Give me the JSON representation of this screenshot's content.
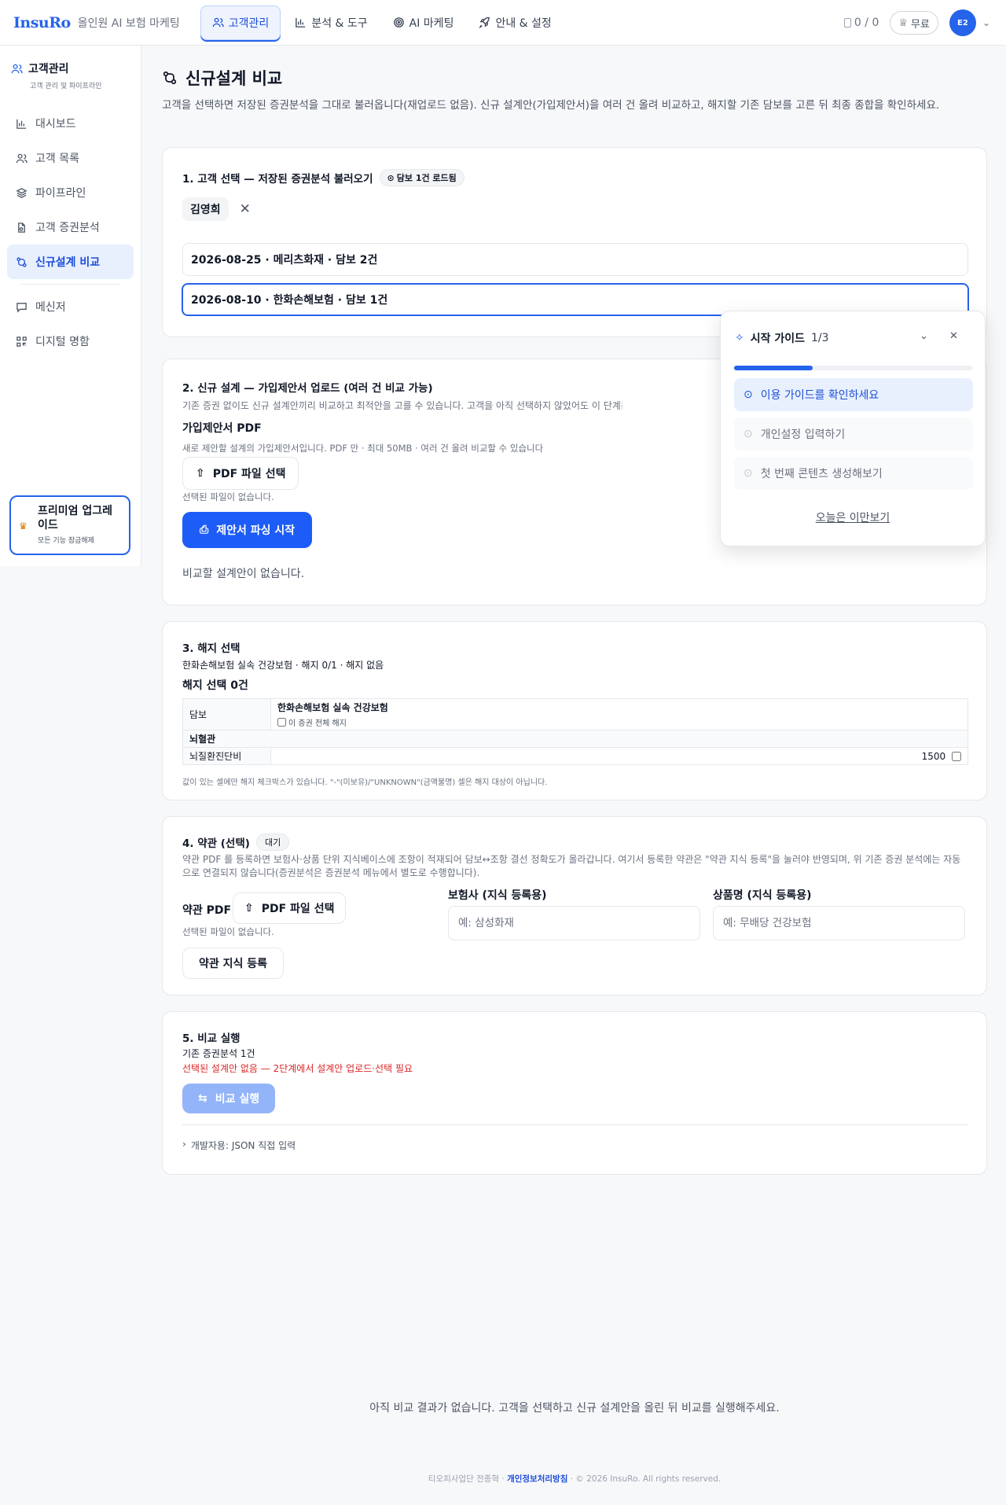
{
  "header": {
    "logo": "InsuRo",
    "logo_sub": "올인원 AI 보험 마케팅",
    "tabs": [
      {
        "label": "고객관리",
        "icon": "users-icon"
      },
      {
        "label": "분석 & 도구",
        "icon": "bar-chart-icon"
      },
      {
        "label": "AI 마케팅",
        "icon": "target-icon"
      },
      {
        "label": "안내 & 설정",
        "icon": "rocket-icon"
      }
    ],
    "credits": "0 / 0",
    "plan": "무료",
    "avatar": "E2"
  },
  "sidebar": {
    "title": "고객관리",
    "subtitle": "고객 관리 및 파이프라인",
    "items": [
      {
        "label": "대시보드",
        "icon": "bar-chart-icon"
      },
      {
        "label": "고객 목록",
        "icon": "users-icon"
      },
      {
        "label": "파이프라인",
        "icon": "layers-icon"
      },
      {
        "label": "고객 증권분석",
        "icon": "file-scan-icon"
      },
      {
        "label": "신규설계 비교",
        "icon": "compare-icon"
      },
      {
        "label": "메신저",
        "icon": "message-icon"
      },
      {
        "label": "디지털 명함",
        "icon": "qr-code-icon"
      }
    ],
    "premium": {
      "title": "프리미엄 업그레이드",
      "subtitle": "모든 기능 잠금해제"
    }
  },
  "page": {
    "title": "신규설계 비교",
    "description": "고객을 선택하면 저장된 증권분석을 그대로 불러옵니다(재업로드 없음). 신규 설계안(가입제안서)을 여러 건 올려 비교하고, 해지할 기존 담보를 고른 뒤 최종 종합을 확인하세요."
  },
  "step1": {
    "title": "1. 고객 선택 — 저장된 증권분석 불러오기",
    "badge": "담보 1건 로드됨",
    "customer": "김영희",
    "analyses": [
      "2026-08-25 · 메리츠화재 · 담보 2건",
      "2026-08-10 · 한화손해보험 · 담보 1건"
    ]
  },
  "step2": {
    "title": "2. 신규 설계 — 가입제안서 업로드 (여러 건 비교 가능)",
    "description": "기존 증권 없이도 신규 설계안끼리 비교하고 최적안을 고를 수 있습니다. 고객을 아직 선택하지 않았어도 이 단계는 그대로 동작",
    "pdf_label": "가입제안서 PDF",
    "pdf_hint": "새로 제안할 설계의 가입제안서입니다. PDF 만 · 최대 50MB · 여러 건 올려 비교할 수 있습니다",
    "file_button": "PDF 파일 선택",
    "no_file": "선택된 파일이 없습니다.",
    "parse_button": "제안서 파싱 시작",
    "empty": "비교할 설계안이 없습니다."
  },
  "step3": {
    "title": "3. 해지 선택",
    "summary": "한화손해보험 실속 건강보험 · 해지 0/1 · 해지 없음",
    "count": "해지 선택 0건",
    "table": {
      "col_label": "담보",
      "policy": "한화손해보험 실속 건강보험",
      "policy_check": "이 증권 전체 해지",
      "group": "뇌혈관",
      "rows": [
        {
          "name": "뇌질환진단비",
          "value": "1500"
        }
      ]
    },
    "note": "값이 있는 셀에만 해지 체크박스가 있습니다. \"-\"(미보유)/\"UNKNOWN\"(금액불명) 셀은 해지 대상이 아닙니다."
  },
  "step4": {
    "title": "4. 약관 (선택)",
    "badge": "대기",
    "description": "약관 PDF 를 등록하면 보험사·상품 단위 지식베이스에 조항이 적재되어 담보↔조항 결선 정확도가 올라갑니다. 여기서 등록한 약관은 \"약관 지식 등록\"을 눌러야 반영되며, 위 기존 증권 분석에는 자동으로 연결되지 않습니다(증권분석은 증권분석 메뉴에서 별도로 수행합니다).",
    "pdf_label": "약관 PDF",
    "file_button": "PDF 파일 선택",
    "no_file": "선택된 파일이 없습니다.",
    "register_button": "약관 지식 등록",
    "insurer_label": "보험사 (지식 등록용)",
    "insurer_placeholder": "예: 삼성화재",
    "product_label": "상품명 (지식 등록용)",
    "product_placeholder": "예: 무배당 건강보험"
  },
  "step5": {
    "title": "5. 비교 실행",
    "base": "기존 증권분석 1건",
    "warning": "선택된 설계안 없음 — 2단계에서 설계안 업로드·선택 필요",
    "run_button": "비교 실행",
    "dev": "개발자용: JSON 직접 입력"
  },
  "guide": {
    "title": "시작 가이드",
    "count": "1/3",
    "progress": 0.33,
    "steps": [
      "이용 가이드를 확인하세요",
      "개인설정 입력하기",
      "첫 번째 콘텐츠 생성해보기"
    ],
    "dismiss": "오늘은 이만보기"
  },
  "footer": {
    "empty_result": "아직 비교 결과가 없습니다. 고객을 선택하고 신규 설계안을 올린 뒤 비교를 실행해주세요.",
    "company": "티오피사업단 전종혁",
    "privacy": "개인정보처리방침",
    "copyright": "© 2026 InsuRo. All rights reserved."
  },
  "colors": {
    "accent": "#2563eb",
    "warning": "#dc2626"
  }
}
